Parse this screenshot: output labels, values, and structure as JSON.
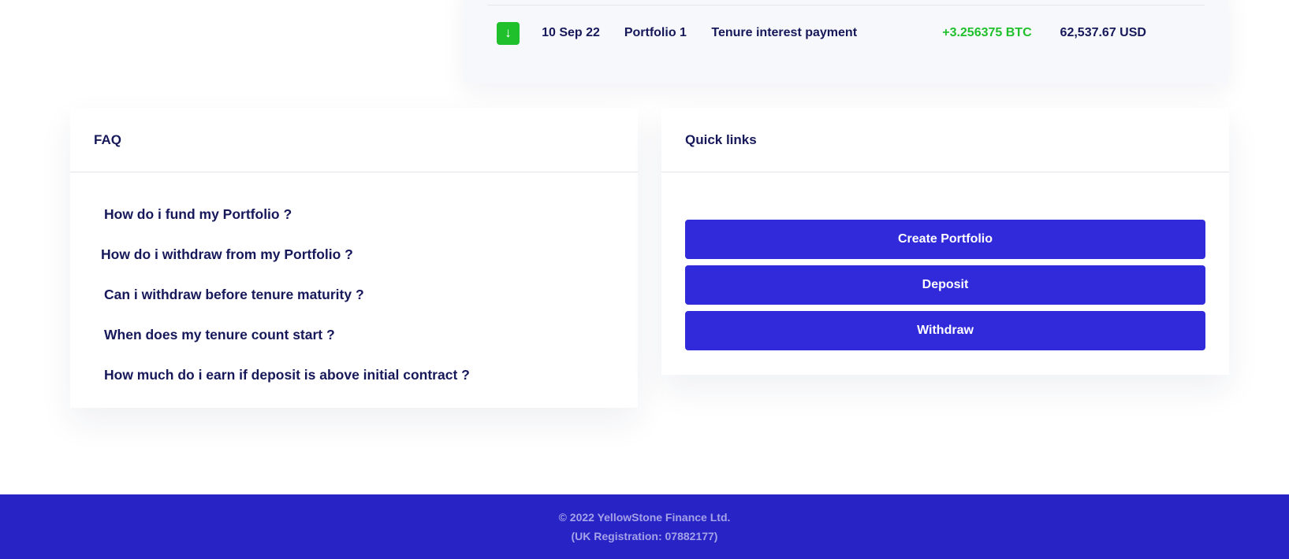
{
  "transactions": {
    "rows": [
      {
        "icon": "arrow-down-icon",
        "icon_glyph": "↓",
        "date": "10 Sep 22",
        "portfolio": "Portfolio 1",
        "description": "Tenure interest payment",
        "amount": "+3.256375 BTC",
        "usd_value": "62,537.67 USD"
      }
    ]
  },
  "faq": {
    "title": "FAQ",
    "items": [
      "How do i fund my Portfolio ?",
      "How do i withdraw from my Portfolio ?",
      "Can i withdraw before tenure maturity ?",
      "When does my tenure count start ?",
      "How much do i earn if deposit is above initial contract ?"
    ]
  },
  "quick_links": {
    "title": "Quick links",
    "buttons": [
      "Create Portfolio",
      "Deposit",
      "Withdraw"
    ]
  },
  "footer": {
    "copyright": "© 2022 YellowStone Finance Ltd.",
    "registration": "(UK Registration: 07882177)"
  },
  "colors": {
    "primary": "#302adb",
    "footer_bg": "#2823c5",
    "positive": "#1fc02c",
    "text": "#16185a"
  }
}
